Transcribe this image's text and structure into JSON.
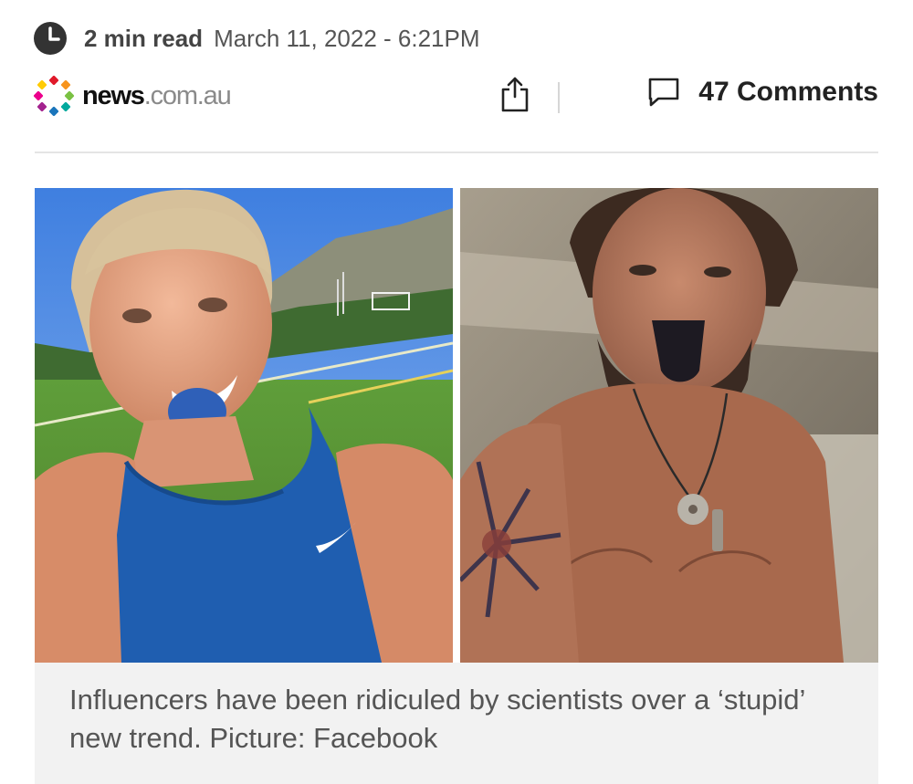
{
  "article": {
    "read_time": "2 min read",
    "timestamp": "March 11, 2022 - 6:21PM",
    "source": {
      "brand_bold": "news",
      "brand_light": ".com.au"
    },
    "comments_label": "47 Comments"
  },
  "icons": {
    "clock": "clock-icon",
    "logo": "news-logo-dots",
    "share": "share-icon",
    "comments": "comment-bubble-icon"
  },
  "colors": {
    "logo_dots": [
      "#e0192a",
      "#f7941d",
      "#7ac143",
      "#00a99d",
      "#1a75bb",
      "#a3238e",
      "#ec008c",
      "#ffcb05"
    ],
    "caption_background": "#f2f2f2"
  },
  "images": [
    {
      "alt": "Woman in blue Nike tank top with blue-stained tongue on a sports field"
    },
    {
      "alt": "Shirtless man with tattoo and pendant sticking out a dark-stained tongue"
    }
  ],
  "caption": "Influencers have been ridiculed by scientists over a ‘stupid’ new trend. Picture: Facebook"
}
